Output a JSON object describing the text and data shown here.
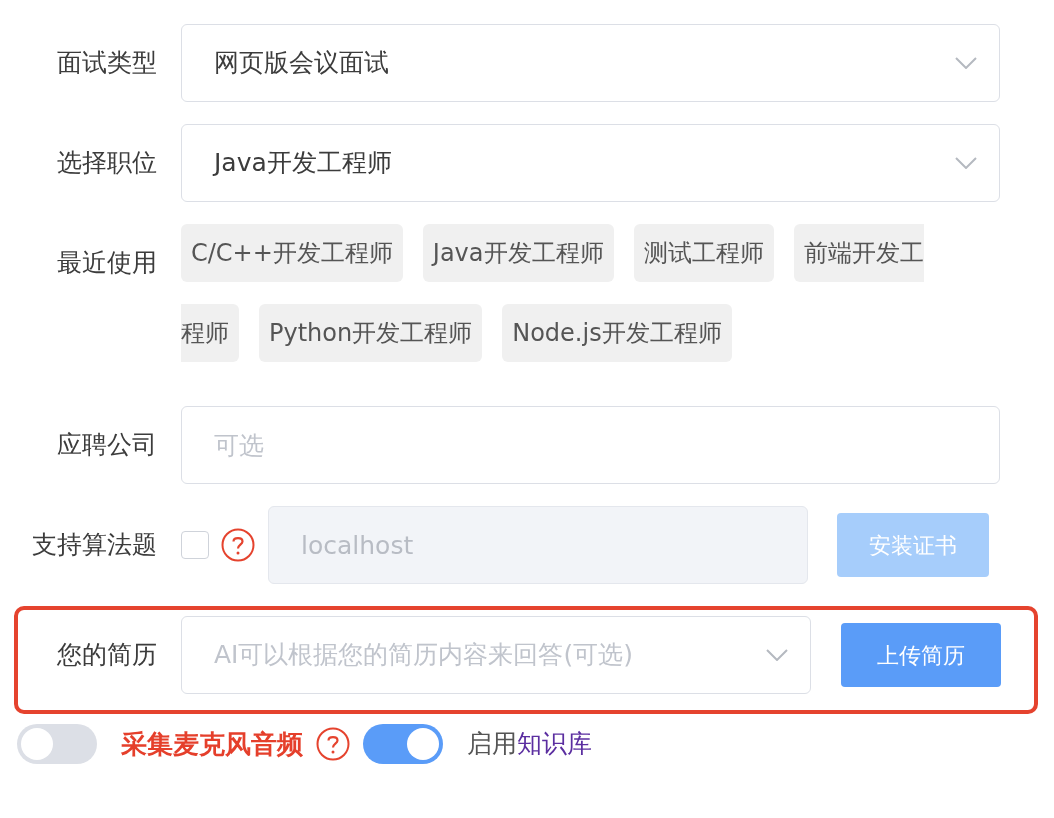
{
  "fields": [
    {
      "kind": "select",
      "label": "面试类型",
      "value": "网页版会议面试"
    },
    {
      "kind": "select",
      "label": "选择职位",
      "value": "Java开发工程师"
    },
    {
      "kind": "chips",
      "label": "最近使用",
      "chips": [
        {
          "text": "C/C++开发工程师"
        },
        {
          "text": "Java开发工程师"
        },
        {
          "text": "测试工程师"
        },
        {
          "lines": [
            "前端开发工",
            "程师"
          ]
        },
        {
          "text": "Python开发工程师"
        },
        {
          "text": "Node.js开发工程师"
        }
      ]
    },
    {
      "kind": "input",
      "label": "应聘公司",
      "placeholder": "可选"
    },
    {
      "kind": "algorithm",
      "label": "支持算法题",
      "checked": false,
      "placeholder": "localhost",
      "disabled": true,
      "button": "安装证书",
      "button_disabled": true
    },
    {
      "kind": "resume",
      "label": "您的简历",
      "placeholder": "AI可以根据您的简历内容来回答(可选)",
      "button": "上传简历",
      "highlighted": true
    }
  ],
  "toggles": [
    {
      "kind": "mic",
      "label": "采集麦克风音频",
      "on": false
    },
    {
      "kind": "knowledge",
      "label": "启用",
      "link": "知识库",
      "on": true
    }
  ]
}
